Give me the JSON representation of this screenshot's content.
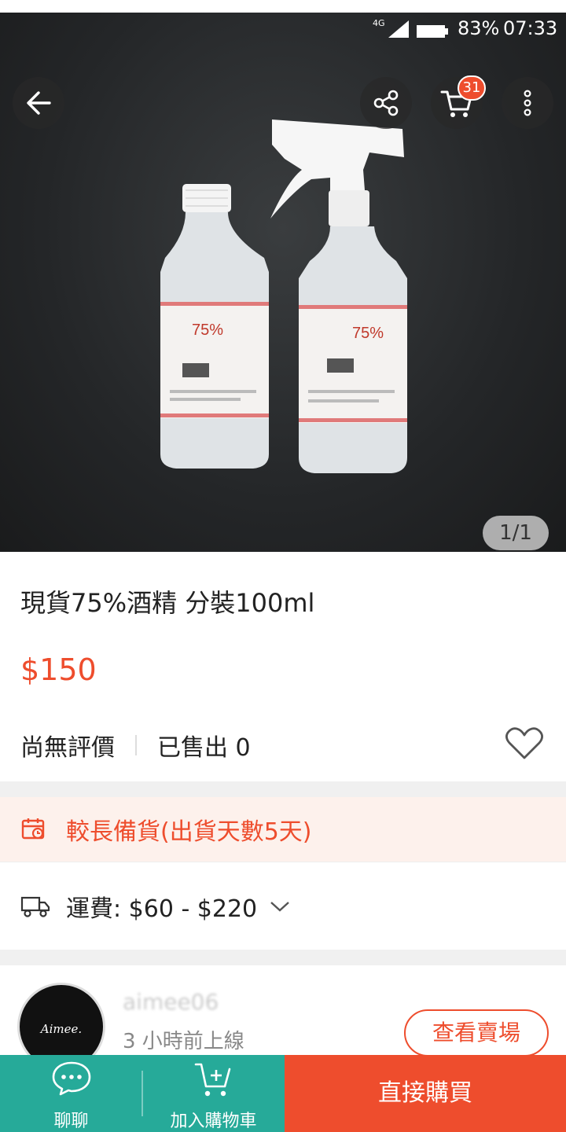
{
  "status_bar": {
    "network": "4G",
    "battery_pct": "83%",
    "time": "07:33"
  },
  "header": {
    "cart_count": "31"
  },
  "gallery": {
    "counter": "1/1",
    "bottle_label_text": "75%"
  },
  "product": {
    "title": "現貨75%酒精 分裝100ml",
    "price": "$150",
    "rating_text": "尚無評價",
    "sold_text": "已售出 0"
  },
  "notice": {
    "text": "較長備貨(出貨天數5天)"
  },
  "shipping": {
    "text": "運費: $60 - $220"
  },
  "shop": {
    "avatar_text": "Aimee.",
    "name": "aimee06",
    "online_status": "3 小時前上線",
    "view_button": "查看賣場"
  },
  "bottom_bar": {
    "chat_label": "聊聊",
    "add_to_cart_label": "加入購物車",
    "buy_now_label": "直接購買"
  },
  "colors": {
    "brand": "#ee4d2d",
    "teal": "#26aa99",
    "notice_bg": "#fdf1ec"
  }
}
